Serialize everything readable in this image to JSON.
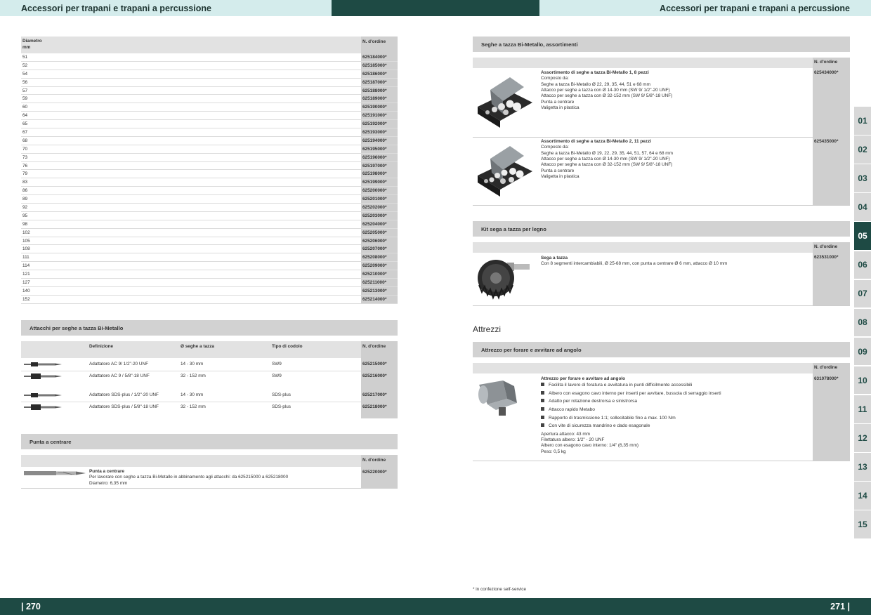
{
  "header": {
    "left_title": "Accessori per trapani e trapani a percussione",
    "right_title": "Accessori per trapani e trapani a percussione"
  },
  "footer": {
    "left_page": "| 270",
    "right_page": "271 |"
  },
  "diam_table": {
    "col1_line1": "Diametro",
    "col1_line2": "mm",
    "col2": "N. d'ordine",
    "rows": [
      [
        "51",
        "625184000*"
      ],
      [
        "52",
        "625185000*"
      ],
      [
        "54",
        "625186000*"
      ],
      [
        "56",
        "625187000*"
      ],
      [
        "57",
        "625188000*"
      ],
      [
        "59",
        "625189000*"
      ],
      [
        "60",
        "625190000*"
      ],
      [
        "64",
        "625191000*"
      ],
      [
        "65",
        "625192000*"
      ],
      [
        "67",
        "625193000*"
      ],
      [
        "68",
        "625194000*"
      ],
      [
        "70",
        "625195000*"
      ],
      [
        "73",
        "625196000*"
      ],
      [
        "76",
        "625197000*"
      ],
      [
        "79",
        "625198000*"
      ],
      [
        "83",
        "625199000*"
      ],
      [
        "86",
        "625200000*"
      ],
      [
        "89",
        "625201000*"
      ],
      [
        "92",
        "625202000*"
      ],
      [
        "95",
        "625203000*"
      ],
      [
        "98",
        "625204000*"
      ],
      [
        "102",
        "625205000*"
      ],
      [
        "105",
        "625206000*"
      ],
      [
        "108",
        "625207000*"
      ],
      [
        "111",
        "625208000*"
      ],
      [
        "114",
        "625209000*"
      ],
      [
        "121",
        "625210000*"
      ],
      [
        "127",
        "625211000*"
      ],
      [
        "140",
        "625213000*"
      ],
      [
        "152",
        "625214000*"
      ]
    ]
  },
  "attacchi": {
    "title": "Attacchi per seghe a tazza Bi-Metallo",
    "headers": [
      "Definizione",
      "Ø seghe a tazza",
      "Tipo di codolo",
      "N. d'ordine"
    ],
    "rows": [
      [
        "Adattatore AC 9/ 1/2\"-20 UNF",
        "14 - 30 mm",
        "SW9",
        "625215000*"
      ],
      [
        "Adattatore AC 9 / 5/8\"-18 UNF",
        "32 - 152 mm",
        "SW9",
        "625216000*"
      ],
      [
        "Adattatore SDS-plus / 1/2\"-20 UNF",
        "14 - 30 mm",
        "SDS-plus",
        "625217000*"
      ],
      [
        "Adattatore SDS-plus / 5/8\"-18 UNF",
        "32 - 152 mm",
        "SDS-plus",
        "625218000*"
      ]
    ]
  },
  "punta": {
    "title": "Punta a centrare",
    "order_header": "N. d'ordine",
    "name": "Punta a centrare",
    "line1": "Per lavorare con seghe a tazza Bi-Metallo in abbinamento agli attacchi: da 625215000 a 625218000",
    "line2": "Diametro: 6,35 mm",
    "order": "625220000*"
  },
  "seghe": {
    "title": "Seghe a tazza Bi-Metallo, assortimenti",
    "order_header": "N. d'ordine",
    "items": [
      {
        "name": "Assortimento di seghe a tazza Bi-Metallo 1, 8 pezzi",
        "lines": [
          "Composto da:",
          "Seghe a tazza Bi-Metallo Ø 22, 29, 35, 44, 51 e 68 mm",
          "Attacco per seghe a tazza con Ø 14-30 mm (SW 9/ 1/2\"-20 UNF)",
          "Attacco per seghe a tazza con Ø 32-152 mm (SW 9/ 5/8\"-18 UNF)",
          "Punta a centrare",
          "Valigetta in plastica"
        ],
        "order": "625434000*"
      },
      {
        "name": "Assortimento di seghe a tazza Bi-Metallo 2, 11 pezzi",
        "lines": [
          "Composto da:",
          "Seghe a tazza Bi-Metallo Ø 19, 22, 29, 35, 44, 51, 57, 64 e 68 mm",
          "Attacco per seghe a tazza con Ø 14-30 mm (SW 9/ 1/2\"-20 UNF)",
          "Attacco per seghe a tazza con Ø 32-152 mm (SW 9/ 5/8\"-18 UNF)",
          "Punta a centrare",
          "Valigetta in plastica"
        ],
        "order": "625435000*"
      }
    ]
  },
  "kit": {
    "title": "Kit sega a tazza per legno",
    "order_header": "N. d'ordine",
    "name": "Sega a tazza",
    "desc": "Con 8 segmenti intercambiabili, Ø 25-68 mm, con punta a centrare Ø 6 mm, attacco Ø 10 mm",
    "order": "623531000*"
  },
  "attrezzi": {
    "heading": "Attrezzi",
    "title": "Attrezzo per forare e avvitare ad angolo",
    "order_header": "N. d'ordine",
    "name": "Attrezzo per forare e avvitare ad angolo",
    "bullets": [
      "Facilita il lavoro di foratura e avvitatura in punti difficilmente accessibili",
      "Albero con esagono cavo interno per inserti per avvitare, bussola di serraggio inserti",
      "Adatto per rotazione destrorsa e sinistrorsa",
      "Attacco rapido Metabo",
      "Rapporto di trasmissione 1:1; sollecitabile fino a max. 100 Nm",
      "Con vite di sicurezza mandrino e dado esagonale"
    ],
    "specs": [
      "Apertura attacco: 43 mm",
      "Filettatura albero: 1/2\" - 20 UNF",
      "Albero con esagono cavo interno: 1/4\" (6,35 mm)",
      "Peso: 0,5 kg"
    ],
    "order": "631078000*"
  },
  "footnote": "* in confezione self-service",
  "tabs": [
    "01",
    "02",
    "03",
    "04",
    "05",
    "06",
    "07",
    "08",
    "09",
    "10",
    "11",
    "12",
    "13",
    "14",
    "15"
  ],
  "active_tab": "05",
  "colors": {
    "dark_teal": "#1e4a44",
    "light_teal": "#d4ecec",
    "bar_gray": "#d2d2d2"
  }
}
